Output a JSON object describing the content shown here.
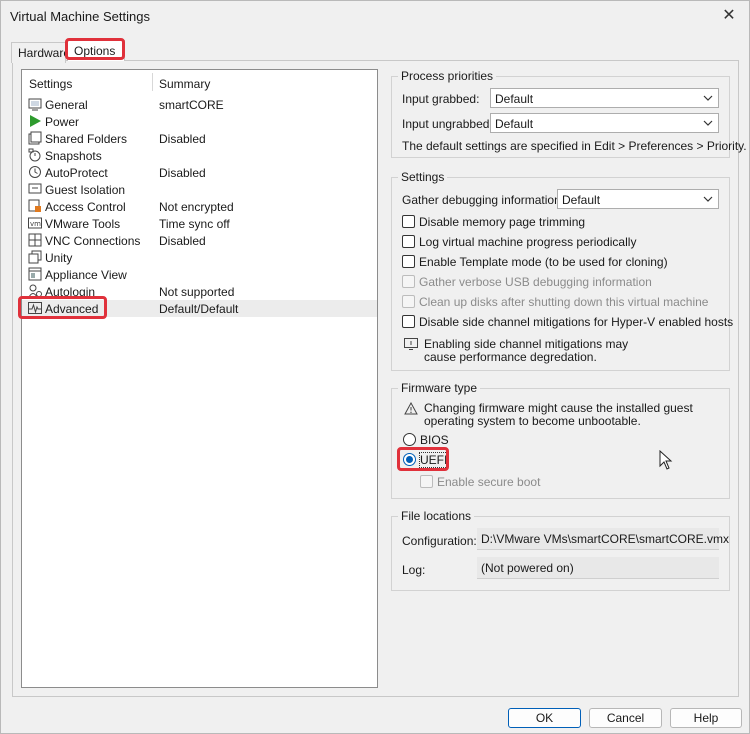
{
  "window": {
    "title": "Virtual Machine Settings",
    "close_glyph": "✕"
  },
  "tabs": [
    {
      "label": "Hardware"
    },
    {
      "label": "Options"
    }
  ],
  "list": {
    "col_settings": "Settings",
    "col_summary": "Summary",
    "items": [
      {
        "label": "General",
        "summary": "smartCORE",
        "icon": "general-icon"
      },
      {
        "label": "Power",
        "summary": "",
        "icon": "power-icon"
      },
      {
        "label": "Shared Folders",
        "summary": "Disabled",
        "icon": "shared-folders-icon"
      },
      {
        "label": "Snapshots",
        "summary": "",
        "icon": "snapshots-icon"
      },
      {
        "label": "AutoProtect",
        "summary": "Disabled",
        "icon": "autoprotect-icon"
      },
      {
        "label": "Guest Isolation",
        "summary": "",
        "icon": "guest-isolation-icon"
      },
      {
        "label": "Access Control",
        "summary": "Not encrypted",
        "icon": "access-control-icon"
      },
      {
        "label": "VMware Tools",
        "summary": "Time sync off",
        "icon": "vmware-tools-icon"
      },
      {
        "label": "VNC Connections",
        "summary": "Disabled",
        "icon": "vnc-icon"
      },
      {
        "label": "Unity",
        "summary": "",
        "icon": "unity-icon"
      },
      {
        "label": "Appliance View",
        "summary": "",
        "icon": "appliance-view-icon"
      },
      {
        "label": "Autologin",
        "summary": "Not supported",
        "icon": "autologin-icon"
      },
      {
        "label": "Advanced",
        "summary": "Default/Default",
        "icon": "advanced-icon"
      }
    ]
  },
  "process_priorities": {
    "title": "Process priorities",
    "input_grabbed_label": "Input grabbed:",
    "input_grabbed_value": "Default",
    "input_ungrabbed_label": "Input ungrabbed:",
    "input_ungrabbed_value": "Default",
    "note": "The default settings are specified in Edit > Preferences > Priority."
  },
  "settings": {
    "title": "Settings",
    "gather_label": "Gather debugging information:",
    "gather_value": "Default",
    "cb_disable_trimming": "Disable memory page trimming",
    "cb_log_progress": "Log virtual machine progress periodically",
    "cb_template_mode": "Enable Template mode (to be used for cloning)",
    "cb_verbose_usb": "Gather verbose USB debugging information",
    "cb_cleanup_disks": "Clean up disks after shutting down this virtual machine",
    "cb_side_channel": "Disable side channel mitigations for Hyper-V enabled hosts",
    "info_line1": "Enabling side channel mitigations may",
    "info_line2": "cause performance degredation."
  },
  "firmware": {
    "title": "Firmware type",
    "warn_line1": "Changing firmware might cause the installed guest",
    "warn_line2": "operating system to become unbootable.",
    "bios_label": "BIOS",
    "uefi_label": "UEFI",
    "secure_boot_label": "Enable secure boot",
    "selected": "UEFI"
  },
  "file_locations": {
    "title": "File locations",
    "config_label": "Configuration:",
    "config_value": "D:\\VMware VMs\\smartCORE\\smartCORE.vmx",
    "log_label": "Log:",
    "log_value": "(Not powered on)"
  },
  "buttons": {
    "ok": "OK",
    "cancel": "Cancel",
    "help": "Help"
  },
  "colors": {
    "highlight": "#e0313b",
    "accent": "#005fb8"
  }
}
